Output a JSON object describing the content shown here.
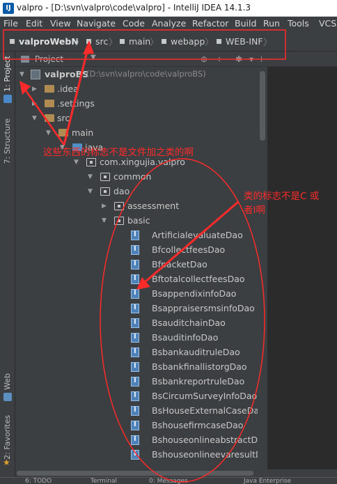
{
  "window": {
    "title": "valpro - [D:\\svn\\valpro\\code\\valpro] - IntelliJ IDEA 14.1.3",
    "app_icon_letter": "IJ"
  },
  "menu": [
    "File",
    "Edit",
    "View",
    "Navigate",
    "Code",
    "Analyze",
    "Refactor",
    "Build",
    "Run",
    "Tools",
    "VCS"
  ],
  "breadcrumb": [
    "valproWebN",
    "src",
    "main",
    "webapp",
    "WEB-INF"
  ],
  "tool_strip": {
    "project_tab": "1: Project",
    "structure_tab": "7: Structure",
    "web_tab": "Web",
    "favorites_tab": "2: Favorites"
  },
  "project_panel": {
    "title": "Project",
    "toolbar_icons": [
      "globe-icon",
      "collapse-icon",
      "settings-icon",
      "hide-icon"
    ]
  },
  "tree": [
    {
      "label": "valproBS",
      "suffix": "(D:\\svn\\valpro\\code\\valproBS)",
      "icon": "module-icon",
      "arrow": "down"
    },
    {
      "label": ".idea",
      "icon": "folder-icon",
      "arrow": "right"
    },
    {
      "label": ".settings",
      "icon": "folder-icon",
      "arrow": "right"
    },
    {
      "label": "src",
      "icon": "folder-icon",
      "arrow": "down"
    },
    {
      "label": "main",
      "icon": "folder-icon",
      "arrow": "down"
    },
    {
      "label": "java",
      "icon": "source-folder-icon",
      "arrow": "down"
    },
    {
      "label": "com.xingujia.valpro",
      "icon": "package-icon",
      "arrow": "down"
    },
    {
      "label": "common",
      "icon": "package-icon",
      "arrow": "down"
    },
    {
      "label": "dao",
      "icon": "package-icon",
      "arrow": "down"
    },
    {
      "label": "assessment",
      "icon": "package-icon",
      "arrow": "right"
    },
    {
      "label": "basic",
      "icon": "package-icon",
      "arrow": "down"
    },
    {
      "label": "ArtificialevaluateDao",
      "icon": "interface-icon"
    },
    {
      "label": "BfcollectfeesDao",
      "icon": "interface-icon"
    },
    {
      "label": "BfpacketDao",
      "icon": "interface-icon"
    },
    {
      "label": "BftotalcollectfeesDao",
      "icon": "interface-icon"
    },
    {
      "label": "BsappendixinfoDao",
      "icon": "interface-icon"
    },
    {
      "label": "BsappraisersmsinfoDao",
      "icon": "interface-icon"
    },
    {
      "label": "BsauditchainDao",
      "icon": "interface-icon"
    },
    {
      "label": "BsauditinfoDao",
      "icon": "interface-icon"
    },
    {
      "label": "BsbankauditruleDao",
      "icon": "interface-icon"
    },
    {
      "label": "BsbankfinallistorgDao",
      "icon": "interface-icon"
    },
    {
      "label": "BsbankreportruleDao",
      "icon": "interface-icon"
    },
    {
      "label": "BsCircumSurveyInfoDao",
      "icon": "interface-icon"
    },
    {
      "label": "BsHouseExternalCaseDao",
      "icon": "interface-icon"
    },
    {
      "label": "BshousefirmcaseDao",
      "icon": "interface-icon"
    },
    {
      "label": "BshouseonlineabstractDao",
      "icon": "interface-icon"
    },
    {
      "label": "BshouseonlineevaresultDao",
      "icon": "interface-icon"
    }
  ],
  "status_bar": [
    "6: TODO",
    "Terminal",
    "0: Messages",
    "Java Enterprise"
  ],
  "annotations": {
    "note1": "这些东西的标志不是文件加之类的啊",
    "note2_line1": "类的标志不是C 或",
    "note2_line2": "者I啊",
    "color": "#ff2a2a"
  }
}
